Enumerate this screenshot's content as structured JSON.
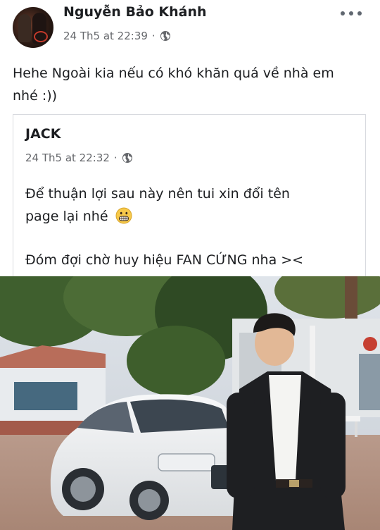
{
  "post": {
    "author": "Nguyễn Bảo Khánh",
    "date": "24 Th5 at 22:39",
    "separator": "·",
    "privacy_icon": "globe-icon",
    "more_icon": "more-options-icon",
    "text_line1": "Hehe Ngoài kia nếu có khó khăn quá về nhà em",
    "text_line2": "nhé :))"
  },
  "shared_post": {
    "author": "JACK",
    "date": "24 Th5 at 22:32",
    "separator": "·",
    "privacy_icon": "globe-icon",
    "line1": "Để thuận lợi sau này nên tui xin đổi tên",
    "line2": "page lại nhé",
    "line2_emoji": "grimacing-face-emoji",
    "line3": "Đóm đợi chờ huy hiệu FAN CỨNG nha ><"
  },
  "colors": {
    "text": "#1c1e21",
    "meta": "#65676b",
    "border": "#d8dadf"
  }
}
